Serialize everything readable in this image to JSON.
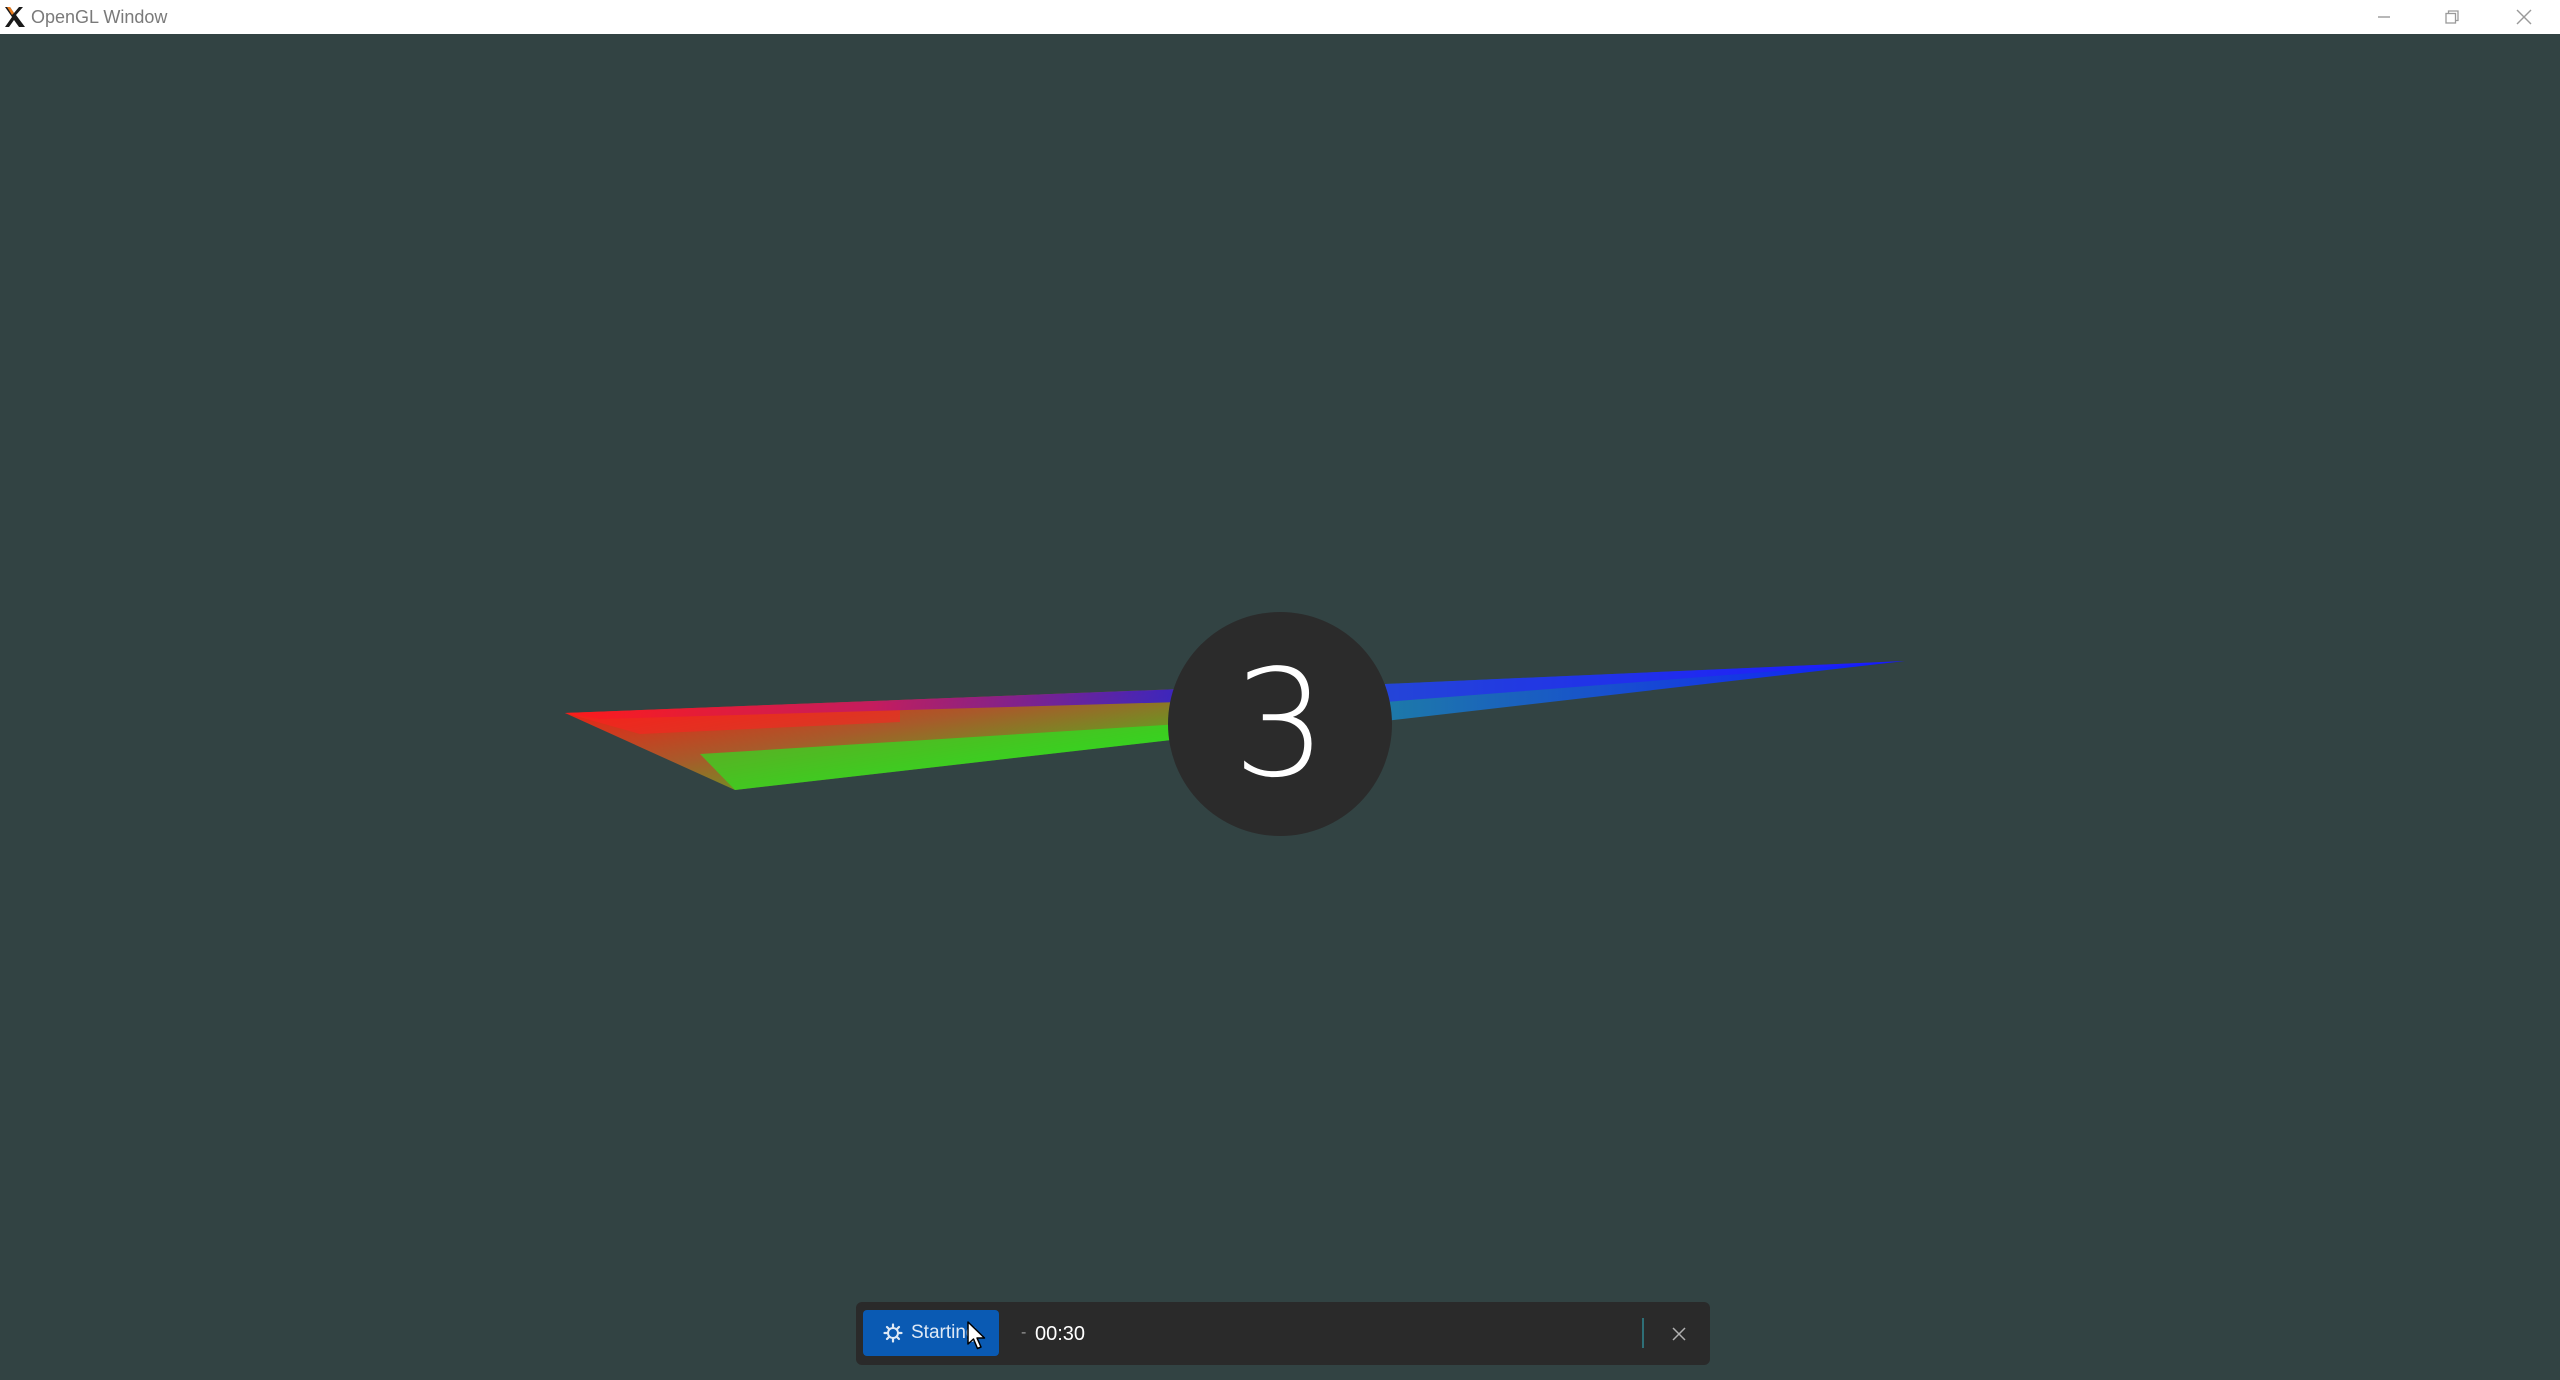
{
  "window": {
    "title": "OpenGL Window",
    "icon": "x-app-icon"
  },
  "titlebar_buttons": {
    "minimize_icon": "minimize-icon",
    "maximize_icon": "restore-icon",
    "close_icon": "close-icon"
  },
  "scene": {
    "background": "#324343",
    "surface_colors": [
      "#ff0000",
      "#00ff00",
      "#0000ff"
    ]
  },
  "countdown": {
    "value": "3"
  },
  "recorder": {
    "start_label": "Starting",
    "indicator": "-",
    "elapsed": "00:30",
    "button_color": "#0a5ab3",
    "close_icon": "close-icon",
    "gear_icon": "gear-icon"
  }
}
